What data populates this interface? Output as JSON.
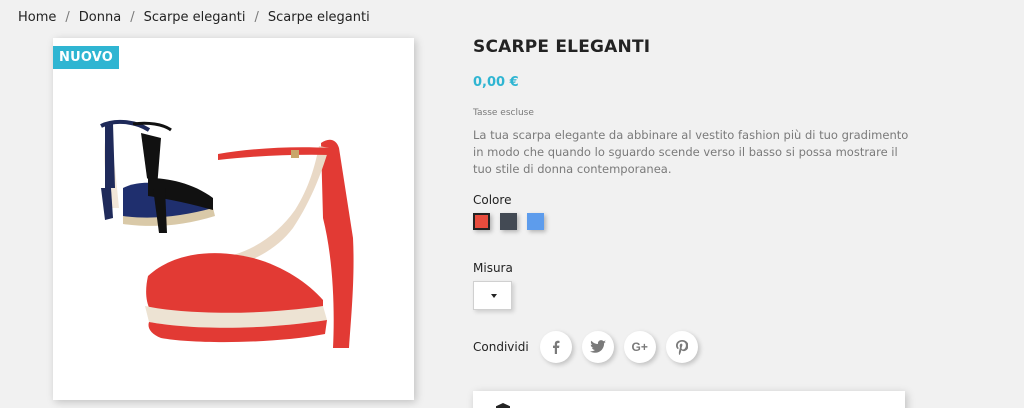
{
  "breadcrumb": [
    "Home",
    "Donna",
    "Scarpe eleganti",
    "Scarpe eleganti"
  ],
  "product": {
    "badge": "NUOVO",
    "title": "SCARPE ELEGANTI",
    "price": "0,00 €",
    "tax_note": "Tasse escluse",
    "description": "La tua scarpa elegante da abbinare al vestito fashion più di tuo gradimento in modo che quando lo sguardo scende verso il basso si possa mostrare il tuo stile di donna contemporanea."
  },
  "variants": {
    "color_label": "Colore",
    "colors": [
      {
        "name": "red",
        "hex": "#e84c3d",
        "selected": true
      },
      {
        "name": "dark-grey",
        "hex": "#434a54",
        "selected": false
      },
      {
        "name": "blue",
        "hex": "#5d9cec",
        "selected": false
      }
    ],
    "size_label": "Misura",
    "size_value": ""
  },
  "share": {
    "label": "Condividi",
    "icons": [
      "facebook-icon",
      "twitter-icon",
      "google-plus-icon",
      "pinterest-icon"
    ]
  },
  "colors": {
    "accent": "#2fb5d2",
    "background": "#f1f1f1",
    "text": "#232323",
    "muted": "#7a7a7a"
  }
}
